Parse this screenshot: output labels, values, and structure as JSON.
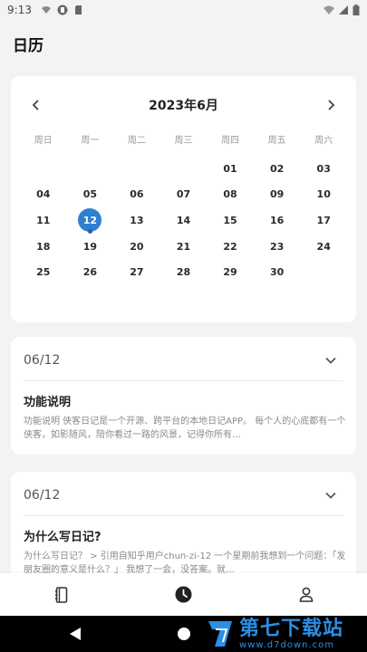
{
  "status_bar": {
    "time": "9:13"
  },
  "page": {
    "title": "日历"
  },
  "calendar": {
    "month_title": "2023年6月",
    "weekdays": [
      "周日",
      "周一",
      "周二",
      "周三",
      "周四",
      "周五",
      "周六"
    ],
    "days": [
      "",
      "",
      "",
      "",
      "01",
      "02",
      "03",
      "04",
      "05",
      "06",
      "07",
      "08",
      "09",
      "10",
      "11",
      "12",
      "13",
      "14",
      "15",
      "16",
      "17",
      "18",
      "19",
      "20",
      "21",
      "22",
      "23",
      "24",
      "25",
      "26",
      "27",
      "28",
      "29",
      "30",
      ""
    ],
    "selected_day": "12",
    "marked_day": "12",
    "accent_color": "#2f7fd1"
  },
  "notes": [
    {
      "date": "06/12",
      "title": "功能说明",
      "body": "功能说明  侠客日记是一个开源、跨平台的本地日记APP。  每个人的心底都有一个侠客，如影随风，陪你看过一路的风景，记得你所有…"
    },
    {
      "date": "06/12",
      "title": "为什么写日记?",
      "body": "为什么写日记？  > 引用自知乎用户chun-zi-12  一个星期前我想到一个问题：「发朋友圈的意义是什么？」  我想了一会，没答案。就…"
    }
  ],
  "bottom_nav": {
    "items": [
      {
        "icon": "diary-book-icon"
      },
      {
        "icon": "clock-icon",
        "active": true
      },
      {
        "icon": "person-icon"
      }
    ]
  },
  "watermark": {
    "main": "第七下载站",
    "sub": "www.d7down.com"
  }
}
